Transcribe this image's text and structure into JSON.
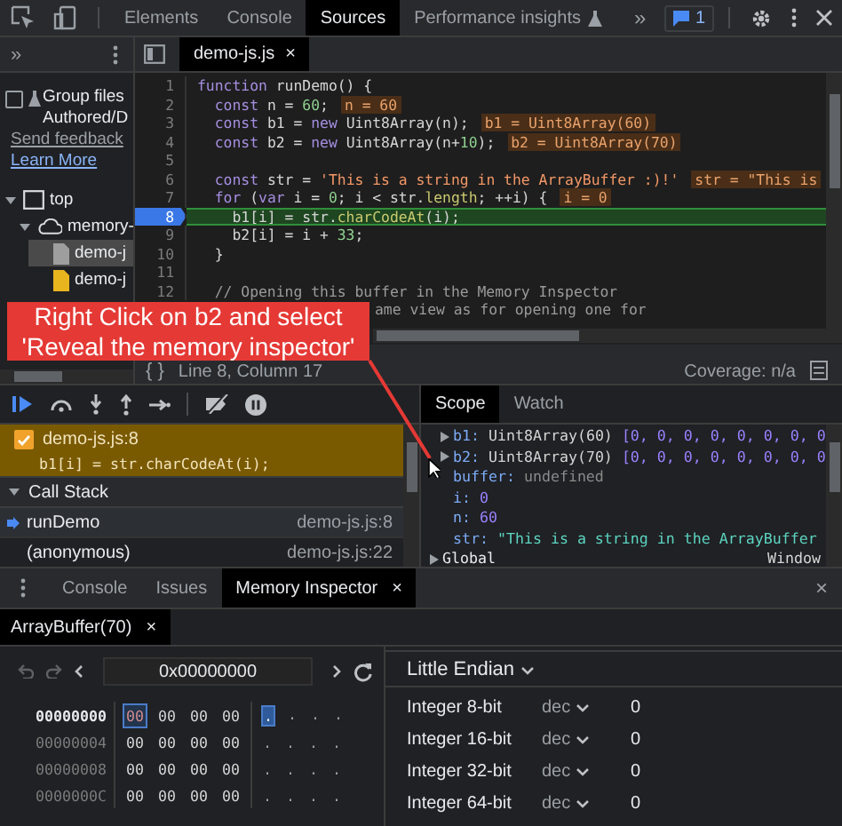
{
  "toolbar": {
    "tabs": [
      {
        "label": "Elements",
        "selected": false
      },
      {
        "label": "Console",
        "selected": false
      },
      {
        "label": "Sources",
        "selected": true
      },
      {
        "label": "Performance insights",
        "selected": false,
        "experimental": true
      }
    ],
    "more": "»",
    "issues_count": "1"
  },
  "navigator": {
    "more": "»",
    "group_files": {
      "lines": [
        "Group files",
        "Authored/D"
      ],
      "checked": false
    },
    "links": [
      "Send feedback",
      "Learn More"
    ],
    "tree": [
      {
        "label": "top",
        "kind": "frame",
        "expanded": true,
        "children": [
          {
            "label": "memory-",
            "kind": "cloud",
            "expanded": true,
            "children": [
              {
                "label": "demo-j",
                "kind": "file",
                "color": "#9e9e9e",
                "selected": true
              },
              {
                "label": "demo-j",
                "kind": "file",
                "color": "#e8b51f",
                "selected": false
              }
            ]
          }
        ]
      }
    ]
  },
  "editor": {
    "tab": "demo-js.js",
    "close": "×",
    "lines": [
      {
        "number": "1",
        "current": false,
        "segments": [
          {
            "kind": "kw",
            "text": "function"
          },
          {
            "kind": "id",
            "text": " runDemo() {"
          }
        ]
      },
      {
        "number": "2",
        "current": false,
        "segments": [
          {
            "kind": "kw",
            "text": "  const"
          },
          {
            "kind": "id",
            "text": " n = "
          },
          {
            "kind": "num",
            "text": "60"
          },
          {
            "kind": "id",
            "text": ";"
          },
          {
            "kind": "inline",
            "text": "n = 60"
          }
        ]
      },
      {
        "number": "3",
        "current": false,
        "segments": [
          {
            "kind": "kw",
            "text": "  const"
          },
          {
            "kind": "id",
            "text": " b1 = "
          },
          {
            "kind": "kw",
            "text": "new"
          },
          {
            "kind": "id",
            "text": " Uint8Array(n);"
          },
          {
            "kind": "inline",
            "text": "b1 = Uint8Array(60)"
          }
        ]
      },
      {
        "number": "4",
        "current": false,
        "segments": [
          {
            "kind": "kw",
            "text": "  const"
          },
          {
            "kind": "id",
            "text": " b2 = "
          },
          {
            "kind": "kw",
            "text": "new"
          },
          {
            "kind": "id",
            "text": " Uint8Array(n+"
          },
          {
            "kind": "num",
            "text": "10"
          },
          {
            "kind": "id",
            "text": ");"
          },
          {
            "kind": "inline",
            "text": "b2 = Uint8Array(70)"
          }
        ]
      },
      {
        "number": "5",
        "current": false
      },
      {
        "number": "6",
        "current": false,
        "segments": [
          {
            "kind": "kw",
            "text": "  const"
          },
          {
            "kind": "id",
            "text": " str = "
          },
          {
            "kind": "str",
            "text": "'This is a string in the ArrayBuffer :)!'"
          },
          {
            "kind": "inline",
            "text": "str = \"This is"
          }
        ]
      },
      {
        "number": "7",
        "current": false,
        "segments": [
          {
            "kind": "kw",
            "text": "  for"
          },
          {
            "kind": "id",
            "text": " ("
          },
          {
            "kind": "kw",
            "text": "var"
          },
          {
            "kind": "id",
            "text": " i = "
          },
          {
            "kind": "num",
            "text": "0"
          },
          {
            "kind": "id",
            "text": "; i < str."
          },
          {
            "kind": "prop",
            "text": "length"
          },
          {
            "kind": "id",
            "text": "; ++i) {"
          },
          {
            "kind": "inline",
            "text": "i = 0"
          }
        ]
      },
      {
        "number": "8",
        "current": true,
        "segments": [
          {
            "kind": "id",
            "text": "    b1[i] = str."
          },
          {
            "kind": "prop",
            "text": "charCodeAt"
          },
          {
            "kind": "id",
            "text": "(i);"
          }
        ]
      },
      {
        "number": "9",
        "current": false,
        "segments": [
          {
            "kind": "id",
            "text": "    b2[i] = i + "
          },
          {
            "kind": "num",
            "text": "33"
          },
          {
            "kind": "id",
            "text": ";"
          }
        ]
      },
      {
        "number": "10",
        "current": false,
        "segments": [
          {
            "kind": "id",
            "text": "  }"
          }
        ]
      },
      {
        "number": "11",
        "current": false
      },
      {
        "number": "12",
        "current": false,
        "segments": [
          {
            "kind": "cm",
            "text": "  // Opening this buffer in the Memory Inspector"
          }
        ]
      },
      {
        "kind": "covered",
        "current": false,
        "segments": [
          {
            "kind": "cm",
            "text": "ame view as for opening one for"
          }
        ]
      }
    ]
  },
  "status_bar": {
    "format": "{ }",
    "position": "Line 8, Column 17",
    "coverage": "Coverage: n/a"
  },
  "annotation": {
    "lines": [
      "Right Click on b2 and select",
      "'Reveal the memory inspector'"
    ]
  },
  "debugger": {
    "breakpoint": {
      "checked": true,
      "location": "demo-js.js:8",
      "code": "b1[i] = str.charCodeAt(i);"
    },
    "call_stack": {
      "title": "Call Stack",
      "expanded": true,
      "frames": [
        {
          "name": "runDemo",
          "location": "demo-js.js:8",
          "selected": true
        },
        {
          "name": "(anonymous)",
          "location": "demo-js.js:22",
          "selected": false
        }
      ]
    }
  },
  "scope": {
    "tabs": [
      {
        "label": "Scope",
        "selected": true
      },
      {
        "label": "Watch",
        "selected": false
      }
    ],
    "entries": [
      {
        "name": "b1:",
        "kind": "array",
        "value": "Uint8Array(60)",
        "items": "[0, 0, 0, 0, 0, 0, 0, 0",
        "expandable": true
      },
      {
        "name": "b2:",
        "kind": "array",
        "value": "Uint8Array(70)",
        "items": "[0, 0, 0, 0, 0, 0, 0, 0",
        "expandable": true
      },
      {
        "name": "buffer:",
        "kind": "undefined",
        "value": "undefined",
        "expandable": false
      },
      {
        "name": "i:",
        "kind": "number",
        "value": "0",
        "expandable": false
      },
      {
        "name": "n:",
        "kind": "number",
        "value": "60",
        "expandable": false
      },
      {
        "name": "str:",
        "kind": "string",
        "value": "\"This is a string in the ArrayBuffer",
        "expandable": false
      },
      {
        "name": "Global",
        "kind": "group",
        "value": "Window",
        "expandable": true
      }
    ]
  },
  "drawer": {
    "tabs": [
      {
        "label": "Console",
        "selected": false
      },
      {
        "label": "Issues",
        "selected": false
      },
      {
        "label": "Memory Inspector",
        "selected": true,
        "close": "×"
      }
    ],
    "close": "×"
  },
  "memory": {
    "buffer_tab": {
      "label": "ArrayBuffer(70)",
      "close": "×"
    },
    "address": "0x00000000",
    "rows": [
      {
        "address": "00000000",
        "selected": true,
        "bytes": [
          {
            "value": "00",
            "selected": true
          },
          {
            "value": "00",
            "selected": false
          },
          {
            "value": "00",
            "selected": false
          },
          {
            "value": "00",
            "selected": false
          }
        ],
        "chars": [
          {
            "value": ".",
            "selected": true
          },
          {
            "value": ".",
            "selected": false
          },
          {
            "value": ".",
            "selected": false
          },
          {
            "value": ".",
            "selected": false
          }
        ]
      },
      {
        "address": "00000004",
        "selected": false,
        "bytes": [
          {
            "value": "00",
            "selected": false
          },
          {
            "value": "00",
            "selected": false
          },
          {
            "value": "00",
            "selected": false
          },
          {
            "value": "00",
            "selected": false
          }
        ],
        "chars": [
          {
            "value": ".",
            "selected": false
          },
          {
            "value": ".",
            "selected": false
          },
          {
            "value": ".",
            "selected": false
          },
          {
            "value": ".",
            "selected": false
          }
        ]
      },
      {
        "address": "00000008",
        "selected": false,
        "bytes": [
          {
            "value": "00",
            "selected": false
          },
          {
            "value": "00",
            "selected": false
          },
          {
            "value": "00",
            "selected": false
          },
          {
            "value": "00",
            "selected": false
          }
        ],
        "chars": [
          {
            "value": ".",
            "selected": false
          },
          {
            "value": ".",
            "selected": false
          },
          {
            "value": ".",
            "selected": false
          },
          {
            "value": ".",
            "selected": false
          }
        ]
      },
      {
        "address": "0000000C",
        "selected": false,
        "bytes": [
          {
            "value": "00",
            "selected": false
          },
          {
            "value": "00",
            "selected": false
          },
          {
            "value": "00",
            "selected": false
          },
          {
            "value": "00",
            "selected": false
          }
        ],
        "chars": [
          {
            "value": ".",
            "selected": false
          },
          {
            "value": ".",
            "selected": false
          },
          {
            "value": ".",
            "selected": false
          },
          {
            "value": ".",
            "selected": false
          }
        ]
      }
    ],
    "endianness": "Little Endian",
    "values": [
      {
        "label": "Integer 8-bit",
        "format": "dec",
        "value": "0"
      },
      {
        "label": "Integer 16-bit",
        "format": "dec",
        "value": "0"
      },
      {
        "label": "Integer 32-bit",
        "format": "dec",
        "value": "0"
      },
      {
        "label": "Integer 64-bit",
        "format": "dec",
        "value": "0"
      }
    ]
  }
}
